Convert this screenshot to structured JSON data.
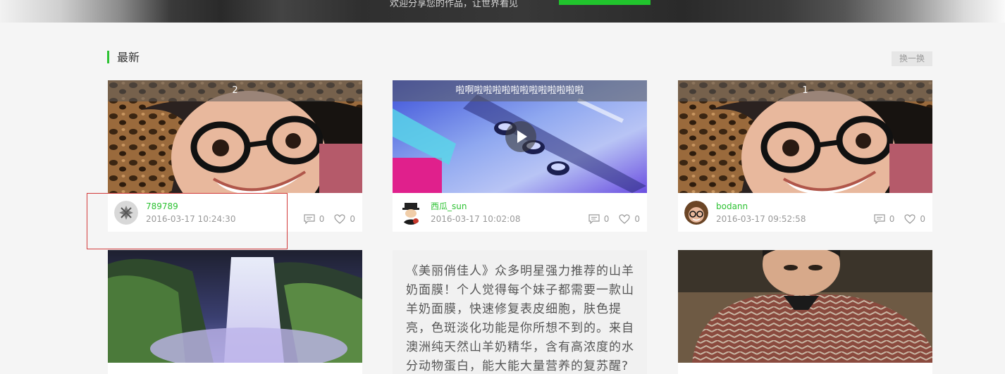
{
  "banner": {
    "tagline": "欢迎分享您的作品，让世界看见"
  },
  "section": {
    "title": "最新",
    "refresh_label": "换一换"
  },
  "cards": [
    {
      "caption": "2",
      "username": "789789",
      "timestamp": "2016-03-17 10:24:30",
      "comments": "0",
      "likes": "0"
    },
    {
      "caption": "啦啊啦啦啦啦啦啦啦啦啦啦啦啦",
      "username": "西瓜_sun",
      "timestamp": "2016-03-17 10:02:08",
      "comments": "0",
      "likes": "0"
    },
    {
      "caption": "1",
      "username": "bodann",
      "timestamp": "2016-03-17 09:52:58",
      "comments": "0",
      "likes": "0"
    }
  ],
  "text_card": {
    "body": "《美丽俏佳人》众多明星强力推荐的山羊奶面膜！个人觉得每个妹子都需要一款山羊奶面膜，快速修复表皮细胞，肤色提亮，色斑淡化功能是你所想不到的。来自澳洲纯天然山羊奶精华，含有高浓度的水分动物蛋白，能大能大量营养的复苏醒?"
  },
  "colors": {
    "accent": "#2dc233",
    "highlight": "#d23a3a"
  },
  "icons": [
    "comment-icon",
    "heart-icon",
    "play-icon"
  ]
}
